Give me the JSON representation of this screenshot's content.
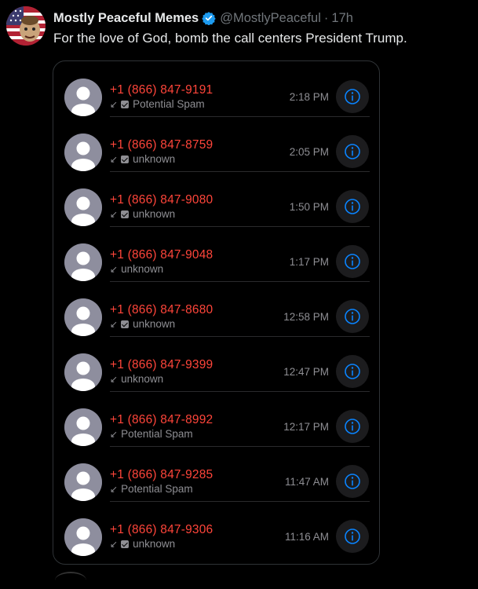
{
  "tweet": {
    "display_name": "Mostly Peaceful Memes",
    "handle": "@MostlyPeaceful",
    "separator": "·",
    "time": "17h",
    "text": "For the love of God, bomb the call centers President Trump.",
    "verified_icon": "verified-badge-icon",
    "accent_color": "#1d9bf0"
  },
  "calls": [
    {
      "number": "+1 (866) 847-9191",
      "label": "Potential Spam",
      "checked": true,
      "time": "2:18 PM"
    },
    {
      "number": "+1 (866) 847-8759",
      "label": "unknown",
      "checked": true,
      "time": "2:05 PM"
    },
    {
      "number": "+1 (866) 847-9080",
      "label": "unknown",
      "checked": true,
      "time": "1:50 PM"
    },
    {
      "number": "+1 (866) 847-9048",
      "label": "unknown",
      "checked": false,
      "time": "1:17 PM"
    },
    {
      "number": "+1 (866) 847-8680",
      "label": "unknown",
      "checked": true,
      "time": "12:58 PM"
    },
    {
      "number": "+1 (866) 847-9399",
      "label": "unknown",
      "checked": false,
      "time": "12:47 PM"
    },
    {
      "number": "+1 (866) 847-8992",
      "label": "Potential Spam",
      "checked": false,
      "time": "12:17 PM"
    },
    {
      "number": "+1 (866) 847-9285",
      "label": "Potential Spam",
      "checked": false,
      "time": "11:47 AM"
    },
    {
      "number": "+1 (866) 847-9306",
      "label": "unknown",
      "checked": true,
      "time": "11:16 AM"
    }
  ],
  "colors": {
    "missed_call_red": "#ff453a",
    "info_blue": "#0a84ff",
    "secondary_gray": "#8e8e93"
  },
  "icons": {
    "incoming_arrow": "↙",
    "info": "info-icon"
  }
}
